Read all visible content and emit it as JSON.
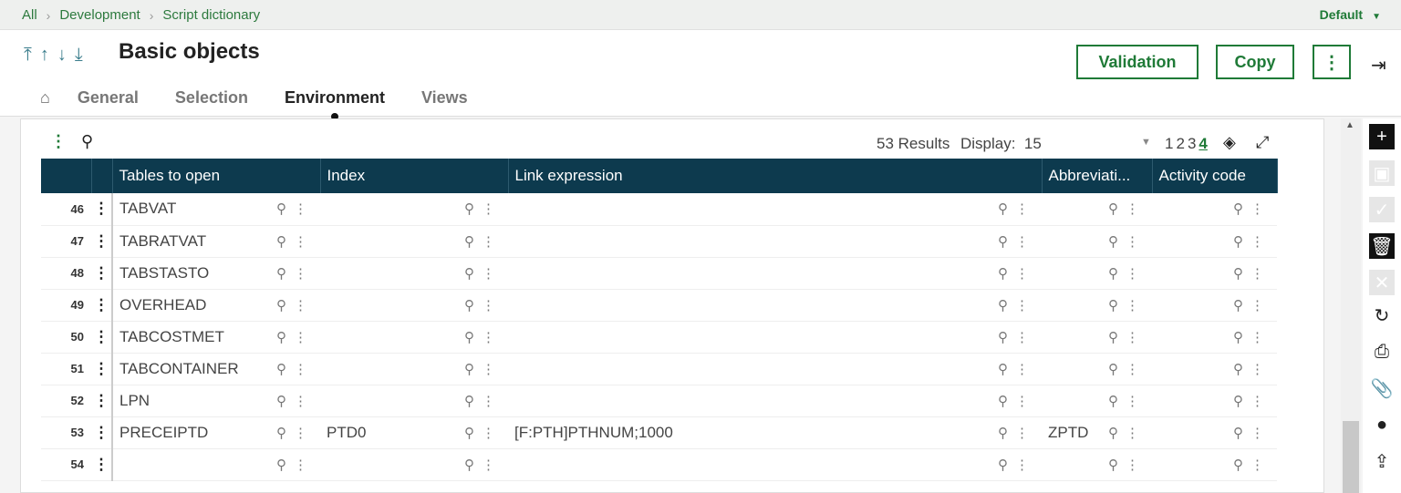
{
  "breadcrumb": [
    "All",
    "Development",
    "Script dictionary"
  ],
  "profile": "Default",
  "page_title": "Basic objects",
  "buttons": {
    "validation": "Validation",
    "copy": "Copy",
    "more": "⋮"
  },
  "tabs": [
    "General",
    "Selection",
    "Environment",
    "Views"
  ],
  "active_tab": "Environment",
  "toolbar": {
    "results": "53 Results",
    "display_label": "Display:",
    "display_value": "15",
    "pages": [
      "1",
      "2",
      "3",
      "4"
    ],
    "current_page": "4"
  },
  "columns": [
    "Tables to open",
    "Index",
    "Link expression",
    "Abbreviati...",
    "Activity code"
  ],
  "rows": [
    {
      "num": "46",
      "table": "TABVAT",
      "index": "",
      "link": "",
      "abbrev": "",
      "activity": ""
    },
    {
      "num": "47",
      "table": "TABRATVAT",
      "index": "",
      "link": "",
      "abbrev": "",
      "activity": ""
    },
    {
      "num": "48",
      "table": "TABSTASTO",
      "index": "",
      "link": "",
      "abbrev": "",
      "activity": ""
    },
    {
      "num": "49",
      "table": "OVERHEAD",
      "index": "",
      "link": "",
      "abbrev": "",
      "activity": ""
    },
    {
      "num": "50",
      "table": "TABCOSTMET",
      "index": "",
      "link": "",
      "abbrev": "",
      "activity": ""
    },
    {
      "num": "51",
      "table": "TABCONTAINER",
      "index": "",
      "link": "",
      "abbrev": "",
      "activity": ""
    },
    {
      "num": "52",
      "table": "LPN",
      "index": "",
      "link": "",
      "abbrev": "",
      "activity": ""
    },
    {
      "num": "53",
      "table": "PRECEIPTD",
      "index": "PTD0",
      "link": "[F:PTH]PTHNUM;1000",
      "abbrev": "ZPTD",
      "activity": ""
    },
    {
      "num": "54",
      "table": "",
      "index": "",
      "link": "",
      "abbrev": "",
      "activity": ""
    }
  ],
  "icons": {
    "search": "search-icon",
    "more": "vertical-dots-icon",
    "home": "home-icon",
    "first": "first-record-icon",
    "prev": "previous-record-icon",
    "next": "next-record-icon",
    "last": "last-record-icon",
    "exit": "exit-icon",
    "layers": "layers-icon",
    "expand": "expand-icon",
    "rail": [
      "add-icon",
      "save-icon",
      "check-icon",
      "delete-icon",
      "cancel-icon",
      "refresh-icon",
      "print-icon",
      "attachment-icon",
      "comment-icon",
      "export-icon"
    ]
  },
  "colors": {
    "accent": "#1f7a37",
    "header_bg": "#0d3a4e"
  }
}
